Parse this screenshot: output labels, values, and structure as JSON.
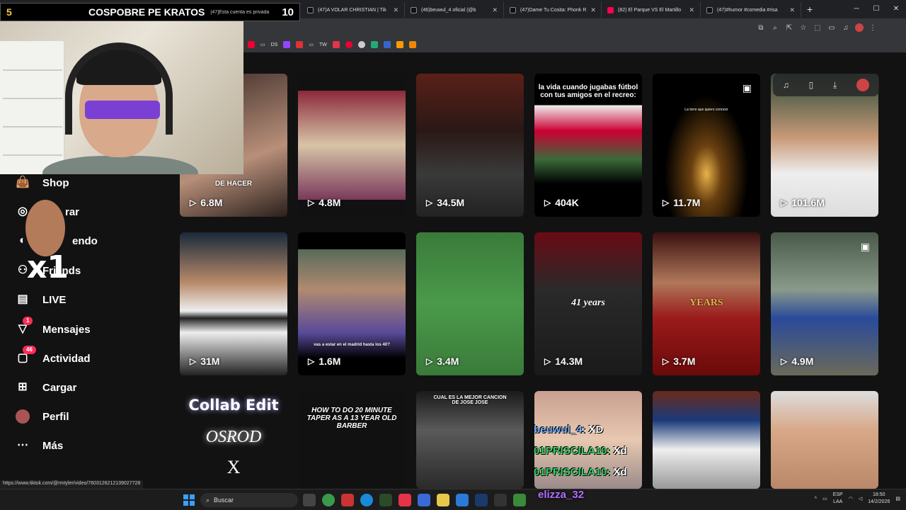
{
  "browser": {
    "tabs": [
      {
        "label": "(47)A VOLAR CHRISTIAN | Tik",
        "icon": "tiktok-icon"
      },
      {
        "label": "(46)beuwul_4 oficial (@b",
        "icon": "tiktok-icon"
      },
      {
        "label": "(47)Dame Tu Cosita: Phonk R",
        "icon": "tiktok-icon"
      },
      {
        "label": "(82) El Parque VS El Martillo",
        "icon": "youtube-icon"
      },
      {
        "label": "(47)#humor #comedia #risa",
        "icon": "tiktok-icon"
      }
    ],
    "bookmarks": [
      "DS",
      "TW"
    ]
  },
  "stream_overlay": {
    "left_number": "5",
    "title": "COSPOBRE PE KRATOS",
    "private_note": "[47]Esta cuenta es privada",
    "right_number": "10"
  },
  "sidebar": {
    "items": [
      {
        "label": "Shop",
        "icon": "shopping-bag-icon"
      },
      {
        "label": "Explorar",
        "icon": "compass-icon"
      },
      {
        "label": "Siguiendo",
        "icon": "following-icon"
      },
      {
        "label": "Friends",
        "icon": "friends-icon"
      },
      {
        "label": "LIVE",
        "icon": "live-icon"
      },
      {
        "label": "Mensajes",
        "icon": "send-icon",
        "badge": "1"
      },
      {
        "label": "Actividad",
        "icon": "activity-icon",
        "badge": "46"
      },
      {
        "label": "Cargar",
        "icon": "upload-icon"
      },
      {
        "label": "Perfil",
        "icon": "avatar-icon"
      },
      {
        "label": "Más",
        "icon": "more-icon"
      }
    ],
    "overlay_text": "x1",
    "visible_labels": [
      "Shop",
      "rar",
      "endo",
      "Friends",
      "LIVE",
      "Mensajes",
      "Actividad",
      "Cargar",
      "Perfil",
      "Más"
    ]
  },
  "videos": {
    "row1": [
      {
        "views": "6.8M",
        "caption": "DE HACER"
      },
      {
        "views": "4.8M",
        "caption": ""
      },
      {
        "views": "34.5M",
        "caption": ""
      },
      {
        "views": "404K",
        "caption": "la vida cuando jugabas fútbol con tus amigos en el recreo:"
      },
      {
        "views": "11.7M",
        "caption": "La torre que quiero conocer"
      },
      {
        "views": "101.6M",
        "caption": ""
      }
    ],
    "row2": [
      {
        "views": "31M",
        "caption": ""
      },
      {
        "views": "1.6M",
        "caption": "vas a estar en el madrid hasta los 40?"
      },
      {
        "views": "3.4M",
        "caption": ""
      },
      {
        "views": "14.3M",
        "caption": "41 years"
      },
      {
        "views": "3.7M",
        "caption": "YEARS"
      },
      {
        "views": "4.9M",
        "caption": ""
      }
    ],
    "row3": [
      {
        "views": "",
        "caption": "HOW TO DO 20 MINUTE TAPER AS A 13 YEAR OLD BARBER"
      },
      {
        "views": "",
        "caption": "CUAL ES LA MEJOR CANCION DE JOSE JOSE"
      }
    ]
  },
  "collab": {
    "line1": "Collab Edit",
    "line2": "OSROD",
    "line3": "X"
  },
  "chat": [
    {
      "user": "beuwul_4:",
      "message": "XD"
    },
    {
      "user": "01PRISCILA10:",
      "message": "Xd"
    },
    {
      "user": "01PRISCILA10:",
      "message": "Xd"
    }
  ],
  "status_url": "https://www.tiktok.com/@rmtyler/video/7603126212139027728",
  "taskbar": {
    "search_placeholder": "Buscar",
    "overlay_name": "elizza_32",
    "lang_top": "ESP",
    "lang_bottom": "LAA",
    "time": "18:50",
    "date": "14/2/2026"
  }
}
